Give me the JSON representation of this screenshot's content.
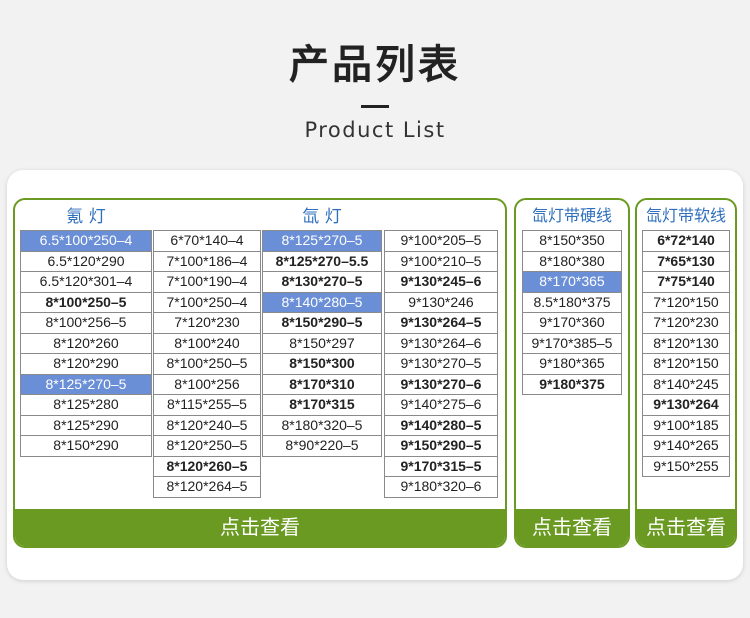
{
  "page": {
    "title": "产品列表",
    "subtitle": "Product List"
  },
  "colors": {
    "accent_green": "#6b9a22",
    "highlight_blue": "#6a8fd6",
    "title_blue": "#2f6fbd"
  },
  "panels": {
    "lamps": {
      "title_left": "氪 灯",
      "title_right": "氙 灯",
      "button": "点击查看",
      "columns": [
        [
          "6.5*100*250–4",
          "6.5*120*290",
          "6.5*120*301–4",
          "8*100*250–5",
          "8*100*256–5",
          "8*120*260",
          "8*120*290",
          "8*125*270–5",
          "8*125*280",
          "8*125*290",
          "8*150*290"
        ],
        [
          "6*70*140–4",
          "7*100*186–4",
          "7*100*190–4",
          "7*100*250–4",
          "7*120*230",
          "8*100*240",
          "8*100*250–5",
          "8*100*256",
          "8*115*255–5",
          "8*120*240–5",
          "8*120*250–5",
          "8*120*260–5",
          "8*120*264–5"
        ],
        [
          "8*125*270–5",
          "8*125*270–5.5",
          "8*130*270–5",
          "8*140*280–5",
          "8*150*290–5",
          "8*150*297",
          "8*150*300",
          "8*170*310",
          "8*170*315",
          "8*180*320–5",
          "8*90*220–5"
        ],
        [
          "9*100*205–5",
          "9*100*210–5",
          "9*130*245–6",
          "9*130*246",
          "9*130*264–5",
          "9*130*264–6",
          "9*130*270–5",
          "9*130*270–6",
          "9*140*275–6",
          "9*140*280–5",
          "9*150*290–5",
          "9*170*315–5",
          "9*180*320–6"
        ]
      ]
    },
    "hard_wire": {
      "title": "氙灯带硬线",
      "button": "点击查看",
      "items": [
        "8*150*350",
        "8*180*380",
        "8*170*365",
        "8.5*180*375",
        "9*170*360",
        "9*170*385–5",
        "9*180*365",
        "9*180*375"
      ]
    },
    "soft_wire": {
      "title": "氙灯带软线",
      "button": "点击查看",
      "items": [
        "6*72*140",
        "7*65*130",
        "7*75*140",
        "7*120*150",
        "7*120*230",
        "8*120*130",
        "8*120*150",
        "8*140*245",
        "9*130*264",
        "9*100*185",
        "9*140*265",
        "9*150*255"
      ]
    }
  }
}
